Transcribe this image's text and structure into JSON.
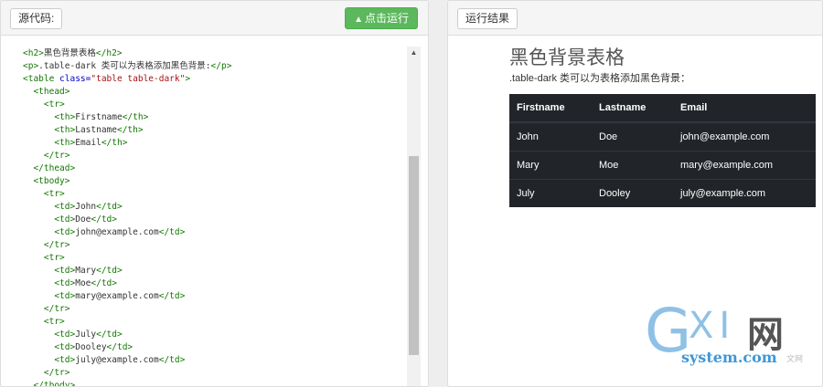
{
  "left_panel": {
    "source_label": "源代码:",
    "run_label": "点击运行",
    "code_lines": [
      [
        {
          "t": "tag",
          "v": "<h2>"
        },
        {
          "t": "txt",
          "v": "黑色背景表格"
        },
        {
          "t": "tag",
          "v": "</h2>"
        }
      ],
      [
        {
          "t": "tag",
          "v": "<p>"
        },
        {
          "t": "txt",
          "v": ".table-dark 类可以为表格添加黑色背景:"
        },
        {
          "t": "tag",
          "v": "</p>"
        }
      ],
      [
        {
          "t": "tag",
          "v": "<table "
        },
        {
          "t": "attr",
          "v": "class="
        },
        {
          "t": "str",
          "v": "\"table table-dark\""
        },
        {
          "t": "tag",
          "v": ">"
        }
      ],
      [
        {
          "t": "txt",
          "v": "  "
        },
        {
          "t": "tag",
          "v": "<thead>"
        }
      ],
      [
        {
          "t": "txt",
          "v": "    "
        },
        {
          "t": "tag",
          "v": "<tr>"
        }
      ],
      [
        {
          "t": "txt",
          "v": "      "
        },
        {
          "t": "tag",
          "v": "<th>"
        },
        {
          "t": "txt",
          "v": "Firstname"
        },
        {
          "t": "tag",
          "v": "</th>"
        }
      ],
      [
        {
          "t": "txt",
          "v": "      "
        },
        {
          "t": "tag",
          "v": "<th>"
        },
        {
          "t": "txt",
          "v": "Lastname"
        },
        {
          "t": "tag",
          "v": "</th>"
        }
      ],
      [
        {
          "t": "txt",
          "v": "      "
        },
        {
          "t": "tag",
          "v": "<th>"
        },
        {
          "t": "txt",
          "v": "Email"
        },
        {
          "t": "tag",
          "v": "</th>"
        }
      ],
      [
        {
          "t": "txt",
          "v": "    "
        },
        {
          "t": "tag",
          "v": "</tr>"
        }
      ],
      [
        {
          "t": "txt",
          "v": "  "
        },
        {
          "t": "tag",
          "v": "</thead>"
        }
      ],
      [
        {
          "t": "txt",
          "v": "  "
        },
        {
          "t": "tag",
          "v": "<tbody>"
        }
      ],
      [
        {
          "t": "txt",
          "v": "    "
        },
        {
          "t": "tag",
          "v": "<tr>"
        }
      ],
      [
        {
          "t": "txt",
          "v": "      "
        },
        {
          "t": "tag",
          "v": "<td>"
        },
        {
          "t": "txt",
          "v": "John"
        },
        {
          "t": "tag",
          "v": "</td>"
        }
      ],
      [
        {
          "t": "txt",
          "v": "      "
        },
        {
          "t": "tag",
          "v": "<td>"
        },
        {
          "t": "txt",
          "v": "Doe"
        },
        {
          "t": "tag",
          "v": "</td>"
        }
      ],
      [
        {
          "t": "txt",
          "v": "      "
        },
        {
          "t": "tag",
          "v": "<td>"
        },
        {
          "t": "txt",
          "v": "john@example.com"
        },
        {
          "t": "tag",
          "v": "</td>"
        }
      ],
      [
        {
          "t": "txt",
          "v": "    "
        },
        {
          "t": "tag",
          "v": "</tr>"
        }
      ],
      [
        {
          "t": "txt",
          "v": "    "
        },
        {
          "t": "tag",
          "v": "<tr>"
        }
      ],
      [
        {
          "t": "txt",
          "v": "      "
        },
        {
          "t": "tag",
          "v": "<td>"
        },
        {
          "t": "txt",
          "v": "Mary"
        },
        {
          "t": "tag",
          "v": "</td>"
        }
      ],
      [
        {
          "t": "txt",
          "v": "      "
        },
        {
          "t": "tag",
          "v": "<td>"
        },
        {
          "t": "txt",
          "v": "Moe"
        },
        {
          "t": "tag",
          "v": "</td>"
        }
      ],
      [
        {
          "t": "txt",
          "v": "      "
        },
        {
          "t": "tag",
          "v": "<td>"
        },
        {
          "t": "txt",
          "v": "mary@example.com"
        },
        {
          "t": "tag",
          "v": "</td>"
        }
      ],
      [
        {
          "t": "txt",
          "v": "    "
        },
        {
          "t": "tag",
          "v": "</tr>"
        }
      ],
      [
        {
          "t": "txt",
          "v": "    "
        },
        {
          "t": "tag",
          "v": "<tr>"
        }
      ],
      [
        {
          "t": "txt",
          "v": "      "
        },
        {
          "t": "tag",
          "v": "<td>"
        },
        {
          "t": "txt",
          "v": "July"
        },
        {
          "t": "tag",
          "v": "</td>"
        }
      ],
      [
        {
          "t": "txt",
          "v": "      "
        },
        {
          "t": "tag",
          "v": "<td>"
        },
        {
          "t": "txt",
          "v": "Dooley"
        },
        {
          "t": "tag",
          "v": "</td>"
        }
      ],
      [
        {
          "t": "txt",
          "v": "      "
        },
        {
          "t": "tag",
          "v": "<td>"
        },
        {
          "t": "txt",
          "v": "july@example.com"
        },
        {
          "t": "tag",
          "v": "</td>"
        }
      ],
      [
        {
          "t": "txt",
          "v": "    "
        },
        {
          "t": "tag",
          "v": "</tr>"
        }
      ],
      [
        {
          "t": "txt",
          "v": "  "
        },
        {
          "t": "tag",
          "v": "</tbody>"
        }
      ]
    ]
  },
  "right_panel": {
    "result_label": "运行结果",
    "heading": "黑色背景表格",
    "description": ".table-dark 类可以为表格添加黑色背景：",
    "table": {
      "headers": [
        "Firstname",
        "Lastname",
        "Email"
      ],
      "rows": [
        [
          "John",
          "Doe",
          "john@example.com"
        ],
        [
          "Mary",
          "Moe",
          "mary@example.com"
        ],
        [
          "July",
          "Dooley",
          "july@example.com"
        ]
      ]
    }
  },
  "watermark": {
    "g": "G",
    "xi": "XI",
    "wang": "网",
    "site": "system.com",
    "small": "文网"
  },
  "colors": {
    "run_button": "#5cb85c",
    "table_bg": "#212529",
    "tag": "#117700",
    "attr": "#0000cc",
    "string": "#aa1111"
  }
}
